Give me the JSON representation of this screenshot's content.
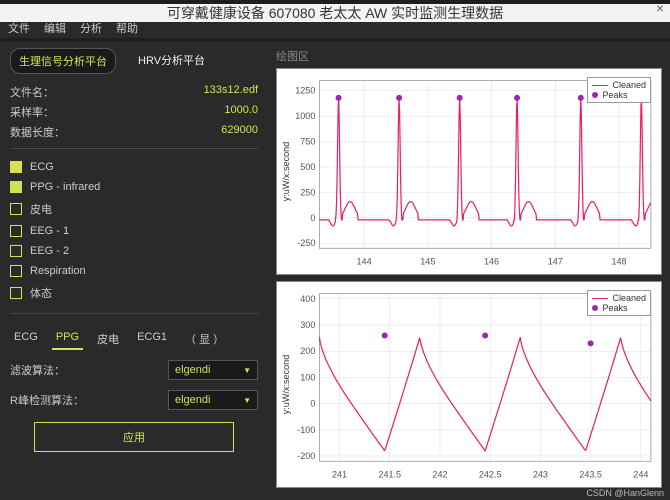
{
  "window": {
    "title": "可穿戴健康设备 607080 老太太 AW 实时监测生理数据",
    "close": "×",
    "icon_prefix": "M"
  },
  "menu": [
    "文件",
    "编辑",
    "分析",
    "帮助"
  ],
  "top_tabs": [
    {
      "label": "生理信号分析平台",
      "active": true
    },
    {
      "label": "HRV分析平台",
      "active": false
    }
  ],
  "file_info": {
    "filename_label": "文件名：",
    "filename": "133s12.edf",
    "samplerate_label": "采样率：",
    "samplerate": "1000.0",
    "length_label": "数据长度：",
    "length": "629000"
  },
  "channels": [
    {
      "label": "ECG",
      "checked": true
    },
    {
      "label": "PPG - infrared",
      "checked": true
    },
    {
      "label": "皮电",
      "checked": false
    },
    {
      "label": "EEG - 1",
      "checked": false
    },
    {
      "label": "EEG - 2",
      "checked": false
    },
    {
      "label": "Respiration",
      "checked": false
    },
    {
      "label": "体态",
      "checked": false
    }
  ],
  "bottom_tabs": [
    {
      "label": "ECG",
      "active": false
    },
    {
      "label": "PPG",
      "active": true
    },
    {
      "label": "皮电",
      "active": false
    },
    {
      "label": "ECG1",
      "active": false
    },
    {
      "label": "（  显 ）",
      "active": false
    }
  ],
  "algo": {
    "filter_label": "滤波算法：",
    "filter_value": "elgendi",
    "peak_label": "R峰检测算法：",
    "peak_value": "elgendi"
  },
  "apply": "应用",
  "main_title": "绘图区",
  "legend": {
    "cleaned": "Cleaned",
    "peaks": "Peaks"
  },
  "watermark": "CSDN @HanGlenn",
  "chart_data": [
    {
      "type": "line",
      "ylabel": "y:uW/x:second",
      "x_ticks": [
        144,
        145,
        146,
        147,
        148
      ],
      "y_ticks": [
        -250,
        0,
        250,
        500,
        750,
        1000,
        1250
      ],
      "ylim": [
        -300,
        1350
      ],
      "xlim": [
        143.3,
        148.5
      ],
      "series": [
        {
          "name": "Cleaned",
          "color": "#e91e63"
        },
        {
          "name": "Peaks",
          "color": "#9c27b0"
        }
      ],
      "peaks_x": [
        143.6,
        144.55,
        145.5,
        146.4,
        147.4,
        148.35
      ],
      "peaks_y": [
        1180,
        1180,
        1180,
        1180,
        1180,
        1180
      ]
    },
    {
      "type": "line",
      "ylabel": "y:uW/x:second",
      "x_ticks": [
        241.0,
        241.5,
        242.0,
        242.5,
        243.0,
        243.5,
        244.0
      ],
      "y_ticks": [
        -200,
        -100,
        0,
        100,
        200,
        300,
        400
      ],
      "ylim": [
        -220,
        420
      ],
      "xlim": [
        240.8,
        244.1
      ],
      "series": [
        {
          "name": "Cleaned",
          "color": "#e91e63"
        },
        {
          "name": "Peaks",
          "color": "#9c27b0"
        }
      ],
      "peaks_x": [
        241.45,
        242.45,
        243.5
      ],
      "peaks_y": [
        260,
        260,
        230
      ]
    }
  ]
}
